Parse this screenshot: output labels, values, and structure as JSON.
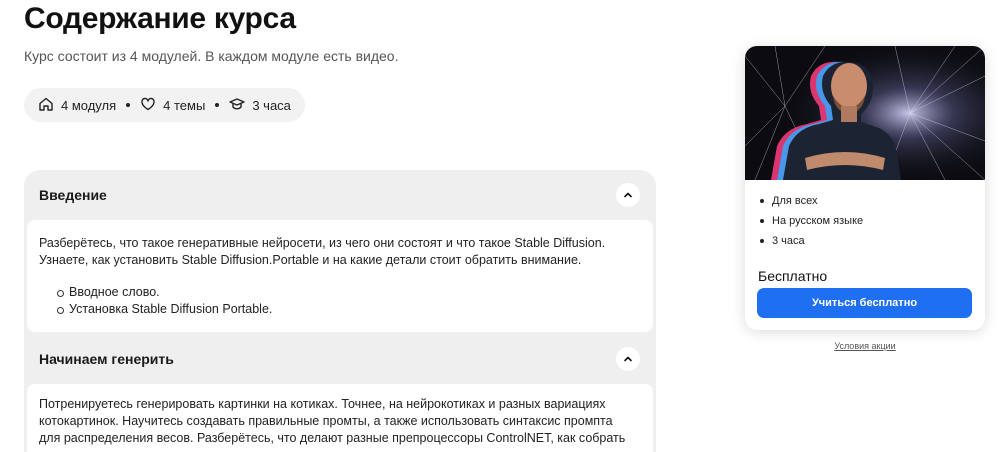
{
  "page": {
    "title": "Содержание курса",
    "subtitle": "Курс состоит из 4 модулей. В каждом модуле есть видео."
  },
  "stats": [
    {
      "icon": "home-icon",
      "label": "4 модуля"
    },
    {
      "icon": "heart-icon",
      "label": "4 темы"
    },
    {
      "icon": "graduation-cap-icon",
      "label": "3 часа"
    }
  ],
  "modules": [
    {
      "title": "Введение",
      "expanded": true,
      "description_line1": "Разберётесь, что такое генеративные нейросети, из чего они состоят и что такое Stable Diffusion.",
      "description_line2": "Узнаете, как установить Stable Diffusion.Portable и на какие детали стоит обратить внимание.",
      "lessons": [
        "Вводное слово.",
        "Установка Stable Diffusion Portable."
      ]
    },
    {
      "title": "Начинаем генерить",
      "expanded": true,
      "description_line1": "Потренируетесь генерировать картинки на котиках. Точнее, на нейрокотиках и разных вариациях",
      "description_line2": "котокартинок. Научитесь создавать правильные промты, а также использовать синтаксис промпта",
      "description_line3": "для распределения весов. Разберётесь, что делают разные препроцессоры ControlNET, как собрать"
    }
  ],
  "card": {
    "features": [
      "Для всех",
      "На русском языке",
      "3 часа"
    ],
    "price": "Бесплатно",
    "cta_label": "Учиться бесплатно",
    "terms_link": "Условия акции",
    "accent_color": "#1f6ff2"
  }
}
